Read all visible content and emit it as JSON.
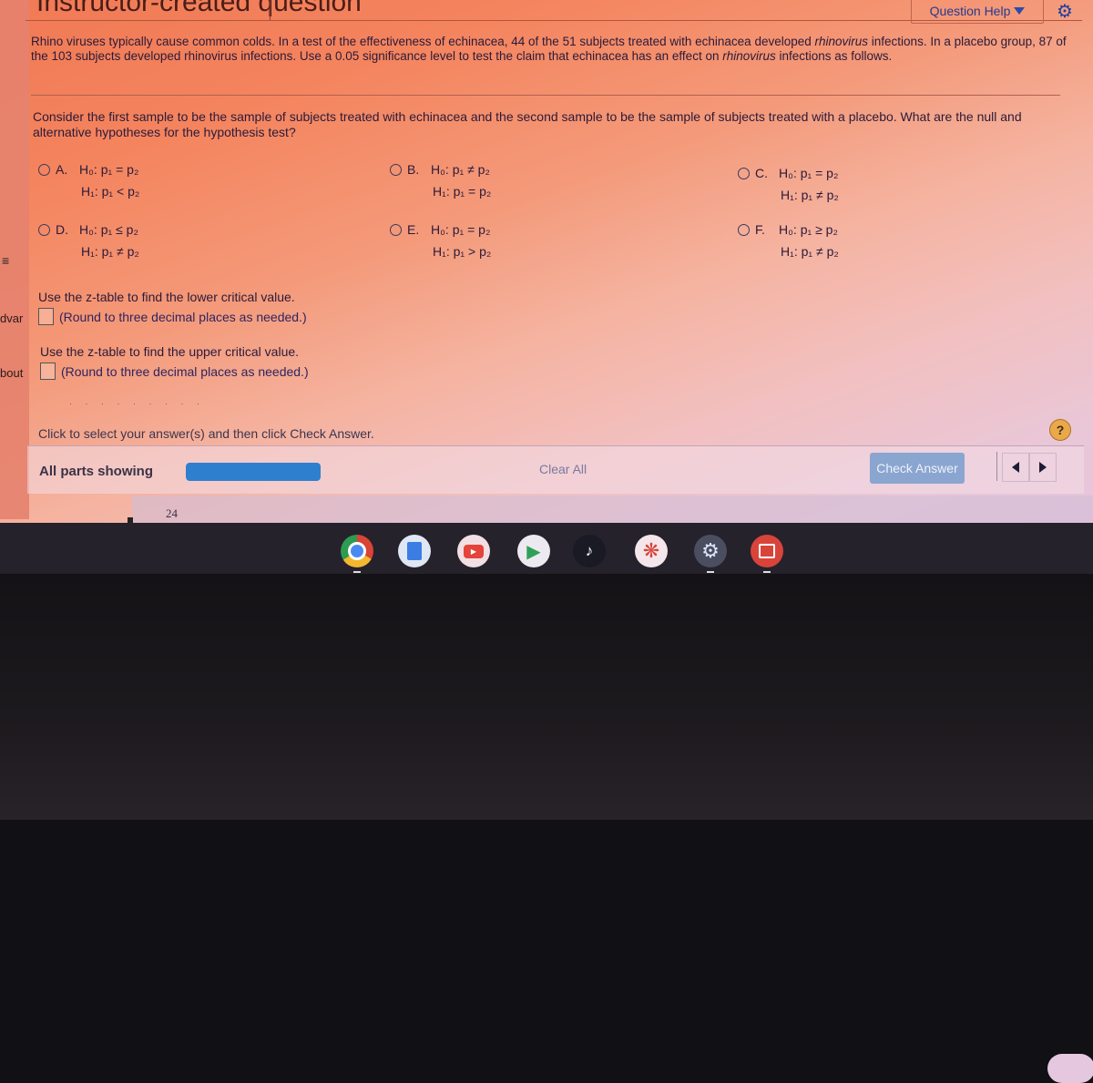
{
  "header": {
    "title_fragment": "Instructor-created question",
    "question_help_label": "Question Help",
    "settings_icon": "gear-icon"
  },
  "left_strip": {
    "fragment_1": "dvar",
    "fragment_2": "bout",
    "menu_icon": "menu-icon"
  },
  "problem": {
    "text_1": "Rhino viruses typically cause common colds. In a test of the effectiveness of echinacea, 44 of the 51 subjects treated with echinacea developed ",
    "term": "rhinovirus",
    "text_2": " infections. In a placebo group, 87 of the 103 subjects developed rhinovirus infections. Use a 0.05 significance level to test the claim that echinacea has an effect on ",
    "text_3": " infections as follows."
  },
  "question": {
    "prompt": "Consider the first sample to be the sample of subjects treated with echinacea and the second sample to be the sample of subjects treated with a placebo. What are the null and alternative hypotheses for the hypothesis test?",
    "options": [
      {
        "letter": "A.",
        "h0": "H₀: p₁ = p₂",
        "h1": "H₁: p₁ < p₂"
      },
      {
        "letter": "B.",
        "h0": "H₀: p₁ ≠ p₂",
        "h1": "H₁: p₁ = p₂"
      },
      {
        "letter": "C.",
        "h0": "H₀: p₁ = p₂",
        "h1": "H₁: p₁ ≠ p₂"
      },
      {
        "letter": "D.",
        "h0": "H₀: p₁ ≤ p₂",
        "h1": "H₁: p₁ ≠ p₂"
      },
      {
        "letter": "E.",
        "h0": "H₀: p₁ = p₂",
        "h1": "H₁: p₁ > p₂"
      },
      {
        "letter": "F.",
        "h0": "H₀: p₁ ≥ p₂",
        "h1": "H₁: p₁ ≠ p₂"
      }
    ],
    "lower_critical": {
      "instruction": "Use the z-table to find the lower critical value.",
      "value": "",
      "hint": "(Round to three decimal places as needed.)"
    },
    "upper_critical": {
      "instruction": "Use the z-table to find the upper critical value.",
      "value": "",
      "hint": "(Round to three decimal places as needed.)"
    },
    "click_instruction": "Click to select your answer(s) and then click Check Answer.",
    "help_symbol": "?"
  },
  "footer": {
    "all_parts_label": "All parts showing",
    "progress_fraction": 1.0,
    "progress_color": "#2f7fcf",
    "clear_all_label": "Clear All",
    "check_answer_label": "Check Answer"
  },
  "background_sheet": {
    "row_number": "24"
  },
  "shelf": {
    "apps": [
      {
        "name": "chrome",
        "icon": "chrome-icon",
        "active": true
      },
      {
        "name": "docs",
        "icon": "docs-icon",
        "active": false
      },
      {
        "name": "youtube",
        "icon": "youtube-icon",
        "active": false
      },
      {
        "name": "play-store",
        "icon": "play-store-icon",
        "active": false
      },
      {
        "name": "tiktok",
        "icon": "tiktok-icon",
        "active": false
      },
      {
        "name": "canvas",
        "icon": "canvas-icon",
        "active": false
      },
      {
        "name": "settings",
        "icon": "settings-icon",
        "active": true
      },
      {
        "name": "gallery",
        "icon": "gallery-icon",
        "active": true
      }
    ]
  }
}
